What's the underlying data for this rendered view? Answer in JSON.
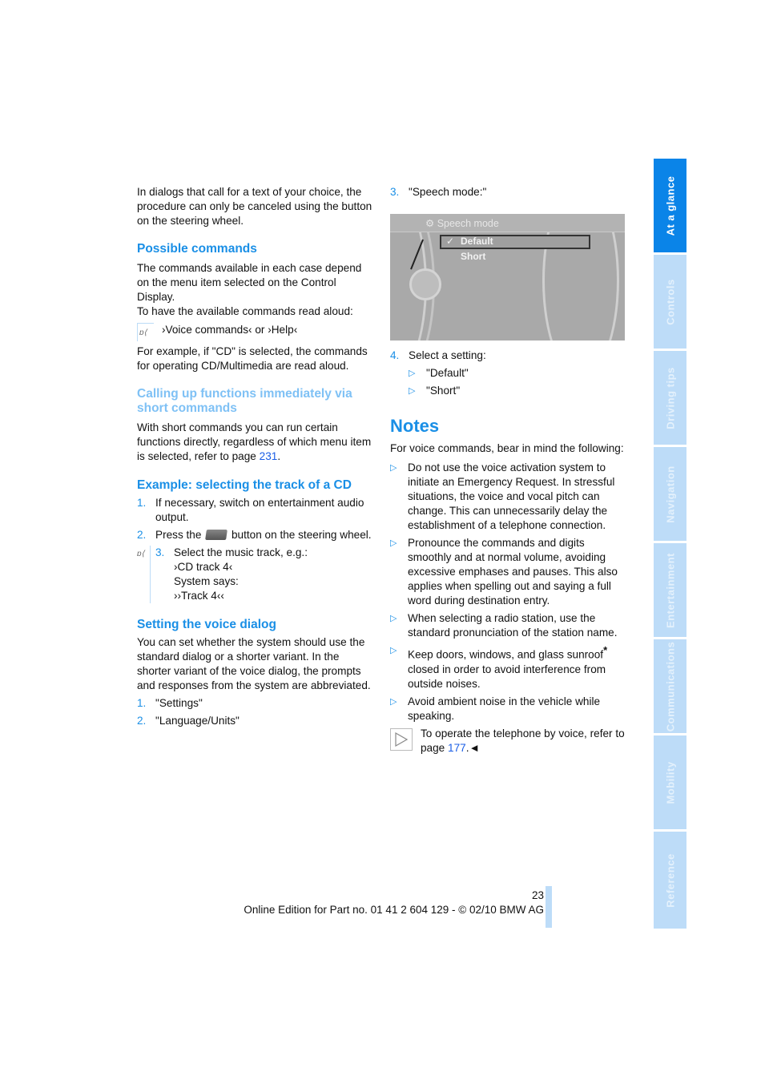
{
  "page": {
    "number": "23",
    "footer": "Online Edition for Part no. 01 41 2 604 129 - © 02/10 BMW AG"
  },
  "side_tabs": [
    {
      "label": "At a glance",
      "active": true
    },
    {
      "label": "Controls",
      "active": false
    },
    {
      "label": "Driving tips",
      "active": false
    },
    {
      "label": "Navigation",
      "active": false
    },
    {
      "label": "Entertainment",
      "active": false
    },
    {
      "label": "Communications",
      "active": false
    },
    {
      "label": "Mobility",
      "active": false
    },
    {
      "label": "Reference",
      "active": false
    }
  ],
  "left": {
    "intro": "In dialogs that call for a text of your choice, the procedure can only be canceled using the button on the steering wheel.",
    "possible_commands": {
      "heading": "Possible commands",
      "p1": "The commands available in each case depend on the menu item selected on the Control Display.",
      "p2": "To have the available commands read aloud:",
      "voice": "›Voice commands‹ or ›Help‹",
      "p3": "For example, if \"CD\" is selected, the commands for operating CD/Multimedia are read aloud."
    },
    "short_commands": {
      "heading": "Calling up functions immediately via short commands",
      "text": "With short commands you can run certain functions directly, regardless of which menu item is selected, refer to page ",
      "page_link": "231",
      "text_end": "."
    },
    "example": {
      "heading": "Example: selecting the track of a CD",
      "steps": [
        {
          "num": "1.",
          "text": "If necessary, switch on entertainment audio output."
        },
        {
          "num": "2.",
          "text_before": "Press the ",
          "text_after": " button on the steering wheel."
        },
        {
          "num": "3.",
          "lines": [
            "Select the music track, e.g.:",
            "›CD track 4‹",
            "System says:",
            "››Track 4‹‹"
          ]
        }
      ]
    },
    "voice_dialog": {
      "heading": "Setting the voice dialog",
      "text": "You can set whether the system should use the standard dialog or a shorter variant. In the shorter variant of the voice dialog, the prompts and responses from the system are abbreviated.",
      "steps": [
        {
          "num": "1.",
          "text": "\"Settings\""
        },
        {
          "num": "2.",
          "text": "\"Language/Units\""
        }
      ]
    }
  },
  "right": {
    "step3": {
      "num": "3.",
      "text": "\"Speech mode:\""
    },
    "screen": {
      "title": "Speech mode",
      "options": [
        {
          "label": "Default",
          "selected": true,
          "checked": true
        },
        {
          "label": "Short",
          "selected": false,
          "checked": false
        }
      ]
    },
    "step4": {
      "num": "4.",
      "text": "Select a setting:"
    },
    "settings": [
      "\"Default\"",
      "\"Short\""
    ],
    "notes": {
      "heading": "Notes",
      "intro": "For voice commands, bear in mind the following:",
      "bullets": [
        "Do not use the voice activation system to initiate an Emergency Request. In stressful situations, the voice and vocal pitch can change. This can unnecessarily delay the establishment of a telephone connection.",
        "Pronounce the commands and digits smoothly and at normal volume, avoiding excessive emphases and pauses. This also applies when spelling out and saying a full word during destination entry.",
        "When selecting a radio station, use the standard pronunciation of the station name.",
        "Keep doors, windows, and glass sunroof",
        "Avoid ambient noise in the vehicle while speaking."
      ],
      "bullet4_star": "*",
      "bullet4_rest": " closed in order to avoid interference from outside noises.",
      "telephone_note": "To operate the telephone by voice, refer to page ",
      "telephone_page": "177",
      "end_mark": ".◄"
    }
  },
  "colors": {
    "accent": "#1a8fe6",
    "tab_active": "#0a84e8",
    "tab_inactive": "#bddcf8",
    "link": "#1a5ee6"
  }
}
